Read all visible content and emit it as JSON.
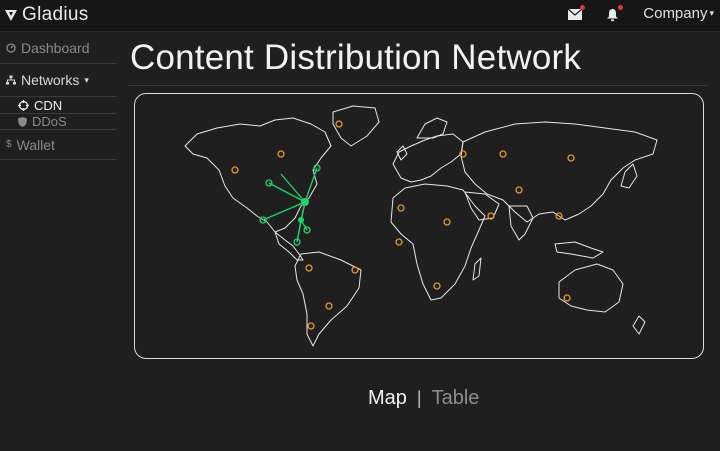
{
  "header": {
    "brand": "Gladius",
    "brand_icon": "gladius-logo-icon",
    "mail_icon": "envelope-icon",
    "bell_icon": "bell-icon",
    "notification_color": "#e2344a",
    "company_label": "Company"
  },
  "sidebar": {
    "dashboard": "Dashboard",
    "networks": "Networks",
    "cdn": "CDN",
    "ddos": "DDoS",
    "wallet": "Wallet"
  },
  "main": {
    "title": "Content Distribution Network",
    "toggle": {
      "map": "Map",
      "separator": "|",
      "table": "Table"
    }
  },
  "map": {
    "node_color": "#e39a2a",
    "route_color": "#1fd46a"
  }
}
